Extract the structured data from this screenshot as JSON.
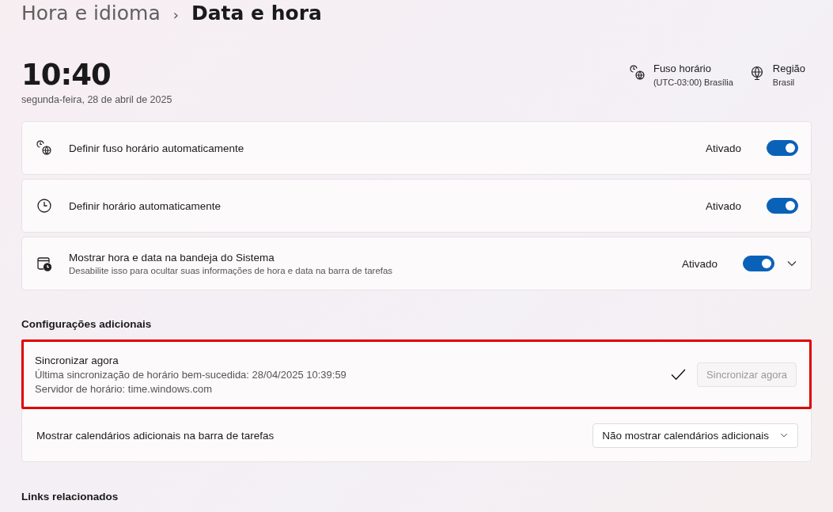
{
  "breadcrumb": {
    "parent": "Hora e idioma",
    "separator": "›",
    "current": "Data e hora"
  },
  "clock": {
    "time": "10:40",
    "date": "segunda-feira, 28 de abril de 2025"
  },
  "header_info": [
    {
      "kind": "timezone",
      "title": "Fuso horário",
      "value": "(UTC-03:00) Brasília"
    },
    {
      "kind": "region",
      "title": "Região",
      "value": "Brasil"
    }
  ],
  "settings": [
    {
      "kind": "timezone",
      "label": "Definir fuso horário automaticamente",
      "status": "Ativado",
      "on": true,
      "expandable": false
    },
    {
      "kind": "time",
      "label": "Definir horário automaticamente",
      "status": "Ativado",
      "on": true,
      "expandable": false
    },
    {
      "kind": "tray",
      "label": "Mostrar hora e data na bandeja do Sistema",
      "description": "Desabilite isso para ocultar suas informações de hora e data na barra de tarefas",
      "status": "Ativado",
      "on": true,
      "expandable": true
    }
  ],
  "additional": {
    "heading": "Configurações adicionais",
    "sync": {
      "title": "Sincronizar agora",
      "lines": [
        "Última sincronização de horário bem-sucedida: 28/04/2025 10:39:59",
        "Servidor de horário: time.windows.com"
      ],
      "succeeded": true,
      "button": "Sincronizar agora",
      "disabled": true,
      "highlighted": true
    },
    "calendars": {
      "label": "Mostrar calendários adicionais na barra de tarefas",
      "value": "Não mostrar calendários adicionais"
    }
  },
  "related": {
    "heading": "Links relacionados"
  }
}
